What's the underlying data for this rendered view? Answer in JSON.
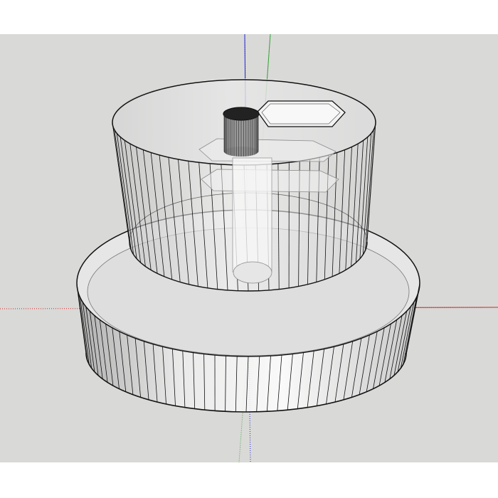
{
  "viewport": {
    "background": "#d9d9d7",
    "axis_colors": {
      "red": "#cc2b2b",
      "green": "#3aa33a",
      "blue": "#2b2bcc"
    },
    "model": {
      "name": "stepped-cylinder-knob",
      "edge_color": "#111111",
      "upper_cylinder_segments": 72,
      "base_cylinder_segments": 96,
      "features": [
        "hex-socket",
        "round-bore",
        "hex-nut-pocket",
        "center-shaft"
      ]
    }
  }
}
